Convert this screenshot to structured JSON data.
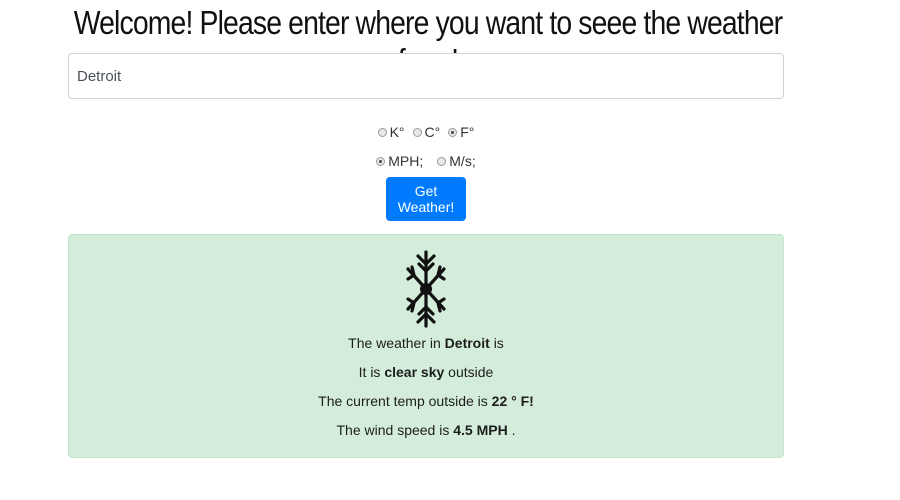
{
  "header": {
    "title": "Welcome! Please enter where you want to seee the weather from!"
  },
  "search": {
    "value": "Detroit"
  },
  "units": {
    "options": [
      "K°",
      "C°",
      "F°"
    ],
    "selected": "F°"
  },
  "speed_units": {
    "options": [
      "MPH;",
      "M/s;"
    ],
    "selected": "MPH;"
  },
  "button": {
    "label": "Get Weather!",
    "color": "#007bff"
  },
  "result": {
    "icon": "snowflake-icon",
    "background": "#d4edda",
    "line1_prefix": "The weather in",
    "city": "Detroit",
    "line1_suffix": "is",
    "line2_prefix": "It is",
    "condition": "clear sky",
    "line2_suffix": "outside",
    "line3_prefix": "The current temp outside is",
    "temp": "22 ° F!",
    "line4_prefix": "The wind speed is",
    "wind": "4.5 MPH",
    "line4_suffix": "."
  }
}
